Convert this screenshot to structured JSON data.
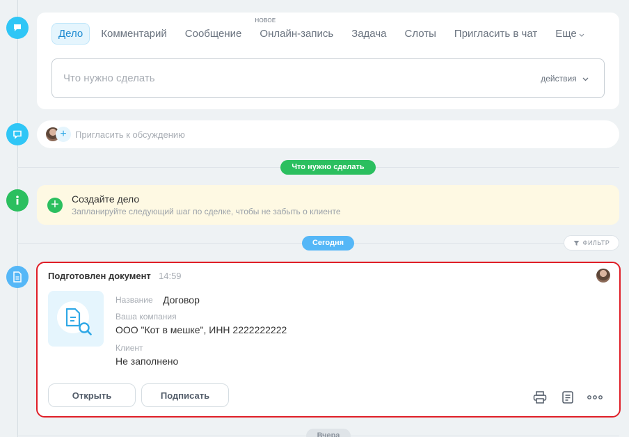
{
  "editor": {
    "tabs": [
      {
        "label": "Дело"
      },
      {
        "label": "Комментарий"
      },
      {
        "label": "Сообщение"
      },
      {
        "label": "Онлайн-запись",
        "badge": "НОВОЕ"
      },
      {
        "label": "Задача"
      },
      {
        "label": "Слоты"
      },
      {
        "label": "Пригласить в чат"
      },
      {
        "label": "Еще"
      }
    ],
    "task_placeholder": "Что нужно сделать",
    "actions_label": "действия"
  },
  "invite": {
    "text": "Пригласить к обсуждению"
  },
  "section_pills": {
    "todo": "Что нужно сделать",
    "today": "Сегодня",
    "yesterday": "Вчера"
  },
  "filter_label": "ФИЛЬТР",
  "create_task": {
    "title": "Создайте дело",
    "subtitle": "Запланируйте следующий шаг по сделке, чтобы не забыть о клиенте"
  },
  "document": {
    "title": "Подготовлен документ",
    "time": "14:59",
    "name_label": "Название",
    "name_value": "Договор",
    "company_label": "Ваша компания",
    "company_value": "ООО \"Кот в мешке\", ИНН 2222222222",
    "client_label": "Клиент",
    "client_value": "Не заполнено",
    "open_button": "Открыть",
    "sign_button": "Подписать"
  },
  "colors": {
    "accent_blue": "#2fc6f6",
    "accent_green": "#2bbf5f",
    "highlight_border": "#e01e27"
  }
}
